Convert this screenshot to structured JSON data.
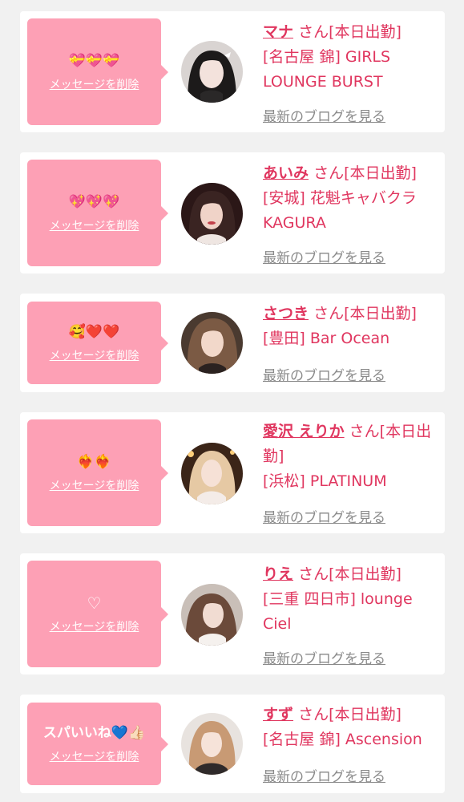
{
  "items": [
    {
      "message": "💝💝💝",
      "delete_label": "メッセージを削除",
      "name": "マナ",
      "suffix": "さん[本日出勤]",
      "shop": "[名古屋 錦] GIRLS LOUNGE BURST",
      "blog_label": "最新のブログを見る"
    },
    {
      "message": "💖💖💖",
      "delete_label": "メッセージを削除",
      "name": "あいみ",
      "suffix": "さん[本日出勤]",
      "shop": "[安城] 花魁キャバクラ KAGURA",
      "blog_label": "最新のブログを見る"
    },
    {
      "message": "🥰❤️❤️",
      "delete_label": "メッセージを削除",
      "name": "さつき",
      "suffix": "さん[本日出勤]",
      "shop": "[豊田] Bar Ocean",
      "blog_label": "最新のブログを見る"
    },
    {
      "message": "❤️‍🔥❤️‍🔥",
      "delete_label": "メッセージを削除",
      "name": "愛沢 えりか",
      "suffix": "さん[本日出勤]",
      "shop": "[浜松] PLATINUM",
      "blog_label": "最新のブログを見る"
    },
    {
      "message": "♡",
      "delete_label": "メッセージを削除",
      "name": "りえ",
      "suffix": "さん[本日出勤]",
      "shop": "[三重 四日市] lounge Ciel",
      "blog_label": "最新のブログを見る"
    },
    {
      "message": "スパいいね💙👍🏻",
      "delete_label": "メッセージを削除",
      "name": "すず",
      "suffix": "さん[本日出勤]",
      "shop": "[名古屋 錦] Ascension",
      "blog_label": "最新のブログを見る"
    }
  ],
  "colors": {
    "bubble": "#fda0b5",
    "accent": "#e0365f",
    "card": "#ffffff",
    "page_bg": "#f1f1f1",
    "muted": "#8a8a8a"
  }
}
